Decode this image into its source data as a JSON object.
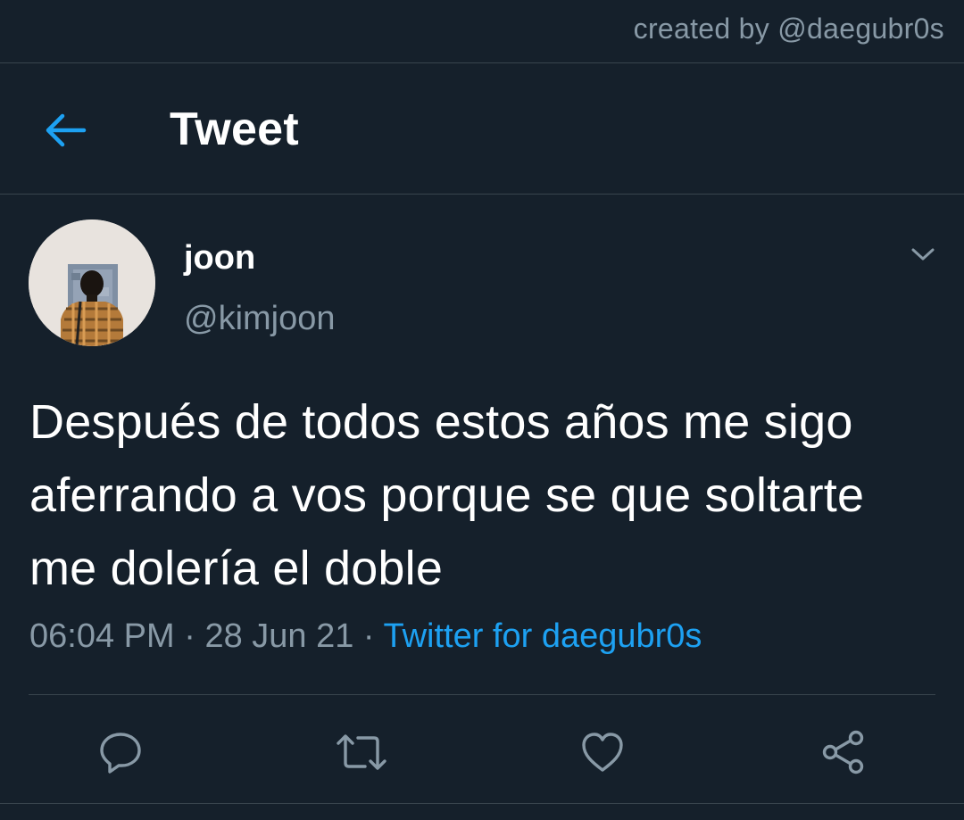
{
  "credit": {
    "text": "created by @daegubr0s"
  },
  "header": {
    "back_icon": "arrow-left-icon",
    "title": "Tweet"
  },
  "tweet": {
    "author": {
      "name": "joon",
      "handle": "@kimjoon"
    },
    "text": "Después de todos estos años me sigo aferrando a vos porque se que soltarte me dolería el doble",
    "meta": {
      "time": "06:04 PM",
      "date": "28 Jun 21",
      "separator": "·",
      "source": "Twitter for daegubr0s"
    },
    "actions": [
      "reply-icon",
      "retweet-icon",
      "like-icon",
      "share-icon"
    ]
  },
  "colors": {
    "background": "#15202b",
    "accent": "#1da1f2",
    "secondary_text": "#8899a6",
    "border": "#38444d"
  }
}
